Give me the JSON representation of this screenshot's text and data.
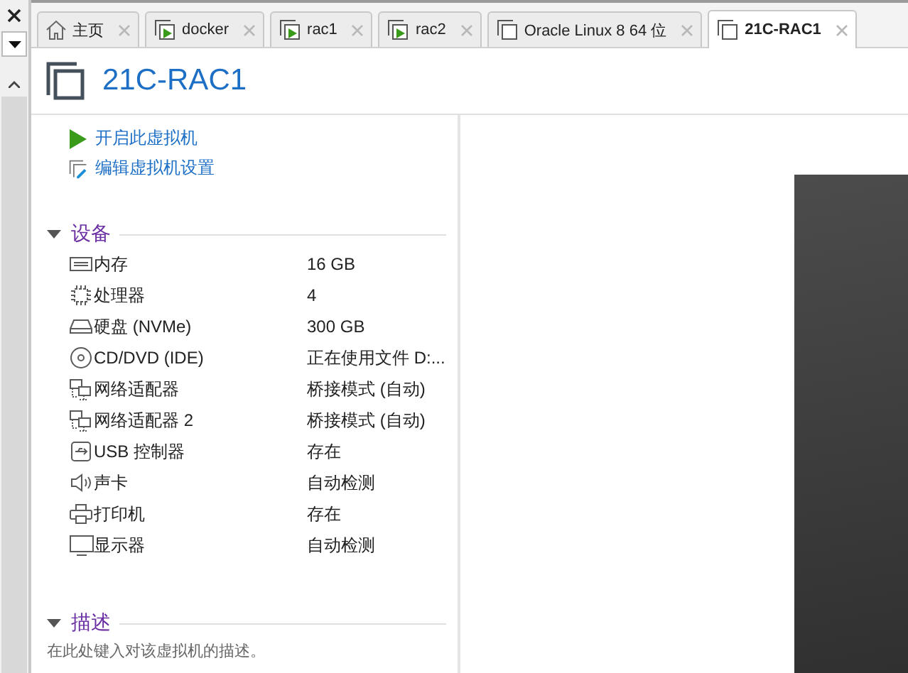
{
  "tabs": [
    {
      "label": "主页",
      "kind": "home",
      "selected": false
    },
    {
      "label": "docker",
      "kind": "vm-running",
      "selected": false
    },
    {
      "label": "rac1",
      "kind": "vm-running",
      "selected": false
    },
    {
      "label": "rac2",
      "kind": "vm-running",
      "selected": false
    },
    {
      "label": "Oracle Linux 8 64 位",
      "kind": "vm",
      "selected": false
    },
    {
      "label": "21C-RAC1",
      "kind": "vm",
      "selected": true
    }
  ],
  "vm": {
    "title": "21C-RAC1"
  },
  "actions": [
    {
      "label": "开启此虚拟机",
      "kind": "power-on"
    },
    {
      "label": "编辑虚拟机设置",
      "kind": "edit"
    }
  ],
  "devices_section": {
    "title": "设备",
    "expanded": true
  },
  "devices": [
    {
      "kind": "memory",
      "name": "内存",
      "value": "16 GB"
    },
    {
      "kind": "cpu",
      "name": "处理器",
      "value": "4"
    },
    {
      "kind": "disk",
      "name": "硬盘 (NVMe)",
      "value": "300 GB"
    },
    {
      "kind": "cd",
      "name": "CD/DVD (IDE)",
      "value": "正在使用文件 D:..."
    },
    {
      "kind": "network",
      "name": "网络适配器",
      "value": "桥接模式 (自动)"
    },
    {
      "kind": "network",
      "name": "网络适配器 2",
      "value": "桥接模式 (自动)"
    },
    {
      "kind": "usb",
      "name": "USB 控制器",
      "value": "存在"
    },
    {
      "kind": "sound",
      "name": "声卡",
      "value": "自动检测"
    },
    {
      "kind": "printer",
      "name": "打印机",
      "value": "存在"
    },
    {
      "kind": "display",
      "name": "显示器",
      "value": "自动检测"
    }
  ],
  "description_section": {
    "title": "描述",
    "expanded": true,
    "placeholder": "在此处键入对该虚拟机的描述。"
  }
}
